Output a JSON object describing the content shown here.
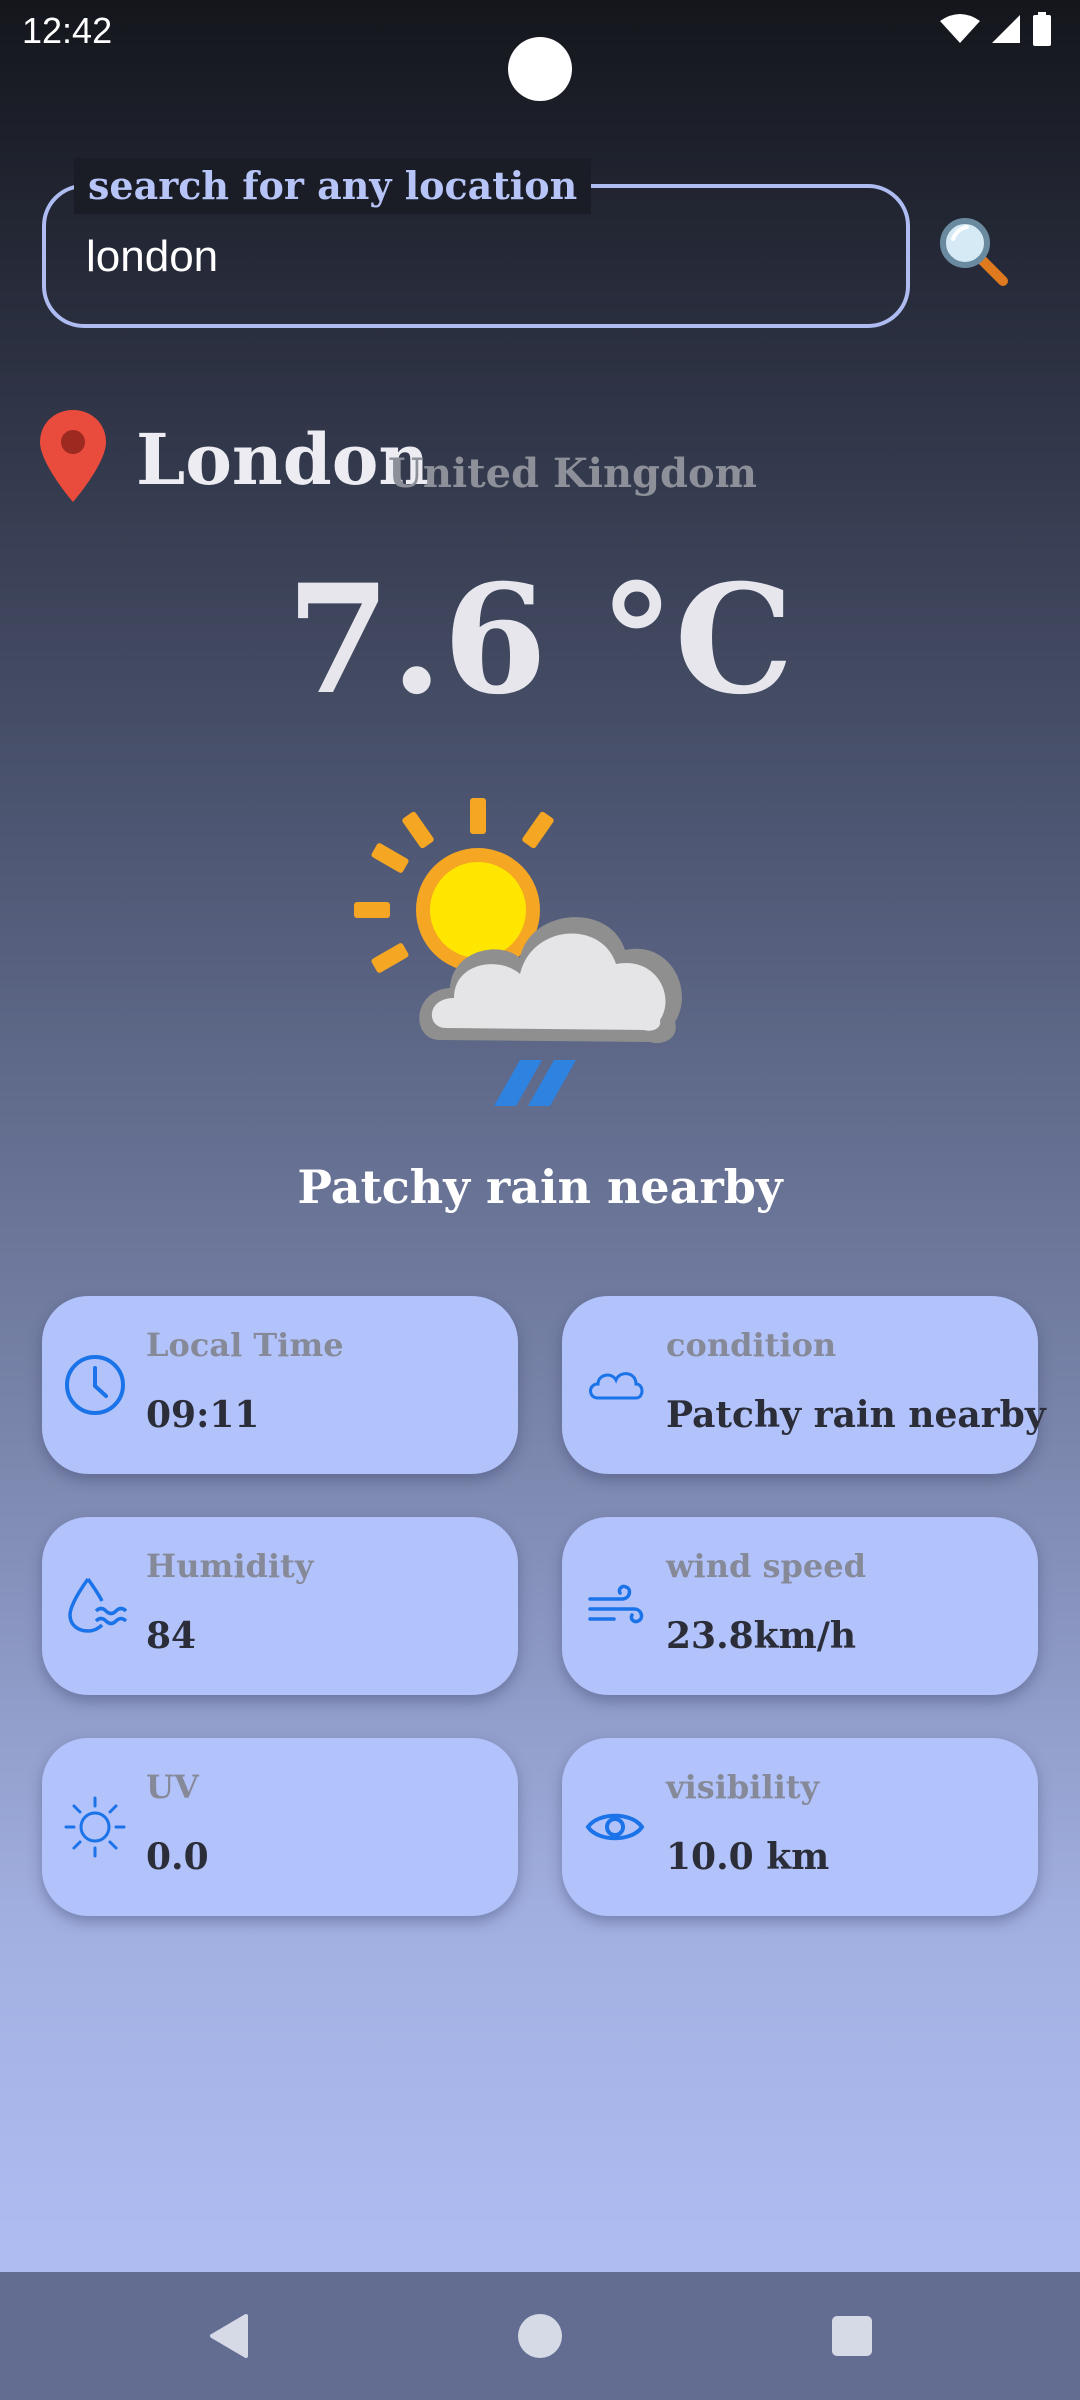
{
  "status_bar": {
    "time": "12:42"
  },
  "search": {
    "label": "search for any location",
    "value": "london"
  },
  "location": {
    "city": "London",
    "country": "United Kingdom"
  },
  "weather": {
    "temperature": "7.6 °C",
    "condition": "Patchy rain nearby"
  },
  "cards": [
    {
      "label": "Local Time",
      "value": "09:11",
      "icon": "clock-icon"
    },
    {
      "label": "condition",
      "value": "Patchy rain nearby",
      "icon": "cloud-icon"
    },
    {
      "label": "Humidity",
      "value": "84",
      "icon": "humidity-icon"
    },
    {
      "label": "wind speed",
      "value": "23.8km/h",
      "icon": "wind-icon"
    },
    {
      "label": "UV",
      "value": "0.0",
      "icon": "sun-icon"
    },
    {
      "label": "visibility",
      "value": "10.0 km",
      "icon": "eye-icon"
    }
  ],
  "colors": {
    "card_bg": "#b2c2fb",
    "accent_icon": "#1a73e8",
    "search_border": "#aebcf2",
    "pin": "#e94b3c"
  }
}
